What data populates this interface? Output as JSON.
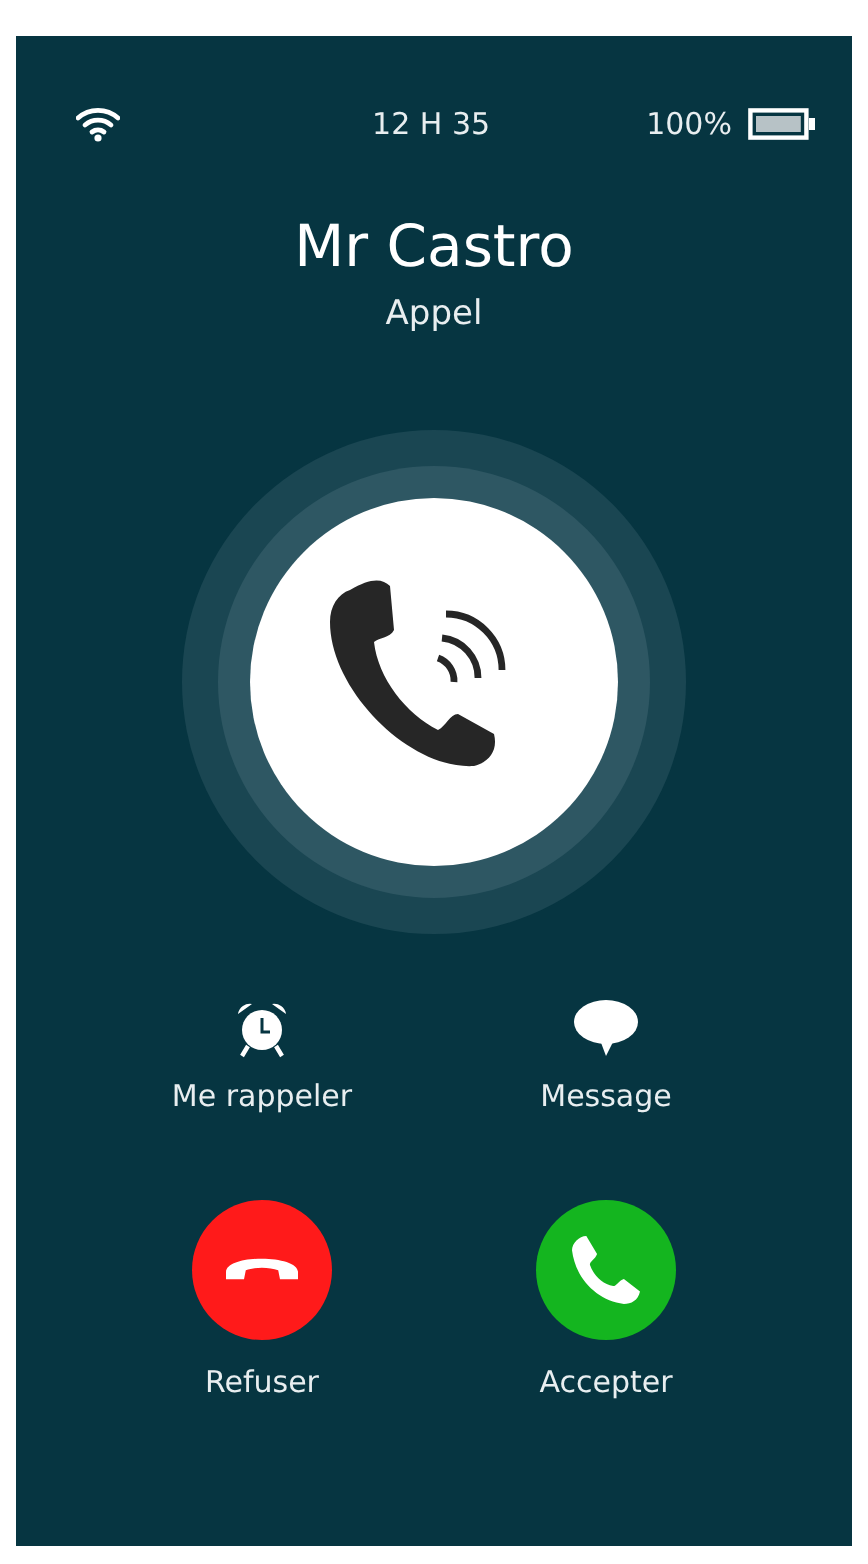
{
  "status_bar": {
    "time": "12 H 35",
    "battery": "100%"
  },
  "caller": {
    "name": "Mr Castro",
    "subtitle": "Appel"
  },
  "actions": [
    {
      "kind": "alarm",
      "label": "Me rappeler"
    },
    {
      "kind": "message",
      "label": "Message"
    }
  ],
  "call_buttons": [
    {
      "kind": "decline",
      "label": "Refuser",
      "color": "#ff1a1a"
    },
    {
      "kind": "accept",
      "label": "Accepter",
      "color": "#14b51f"
    }
  ]
}
